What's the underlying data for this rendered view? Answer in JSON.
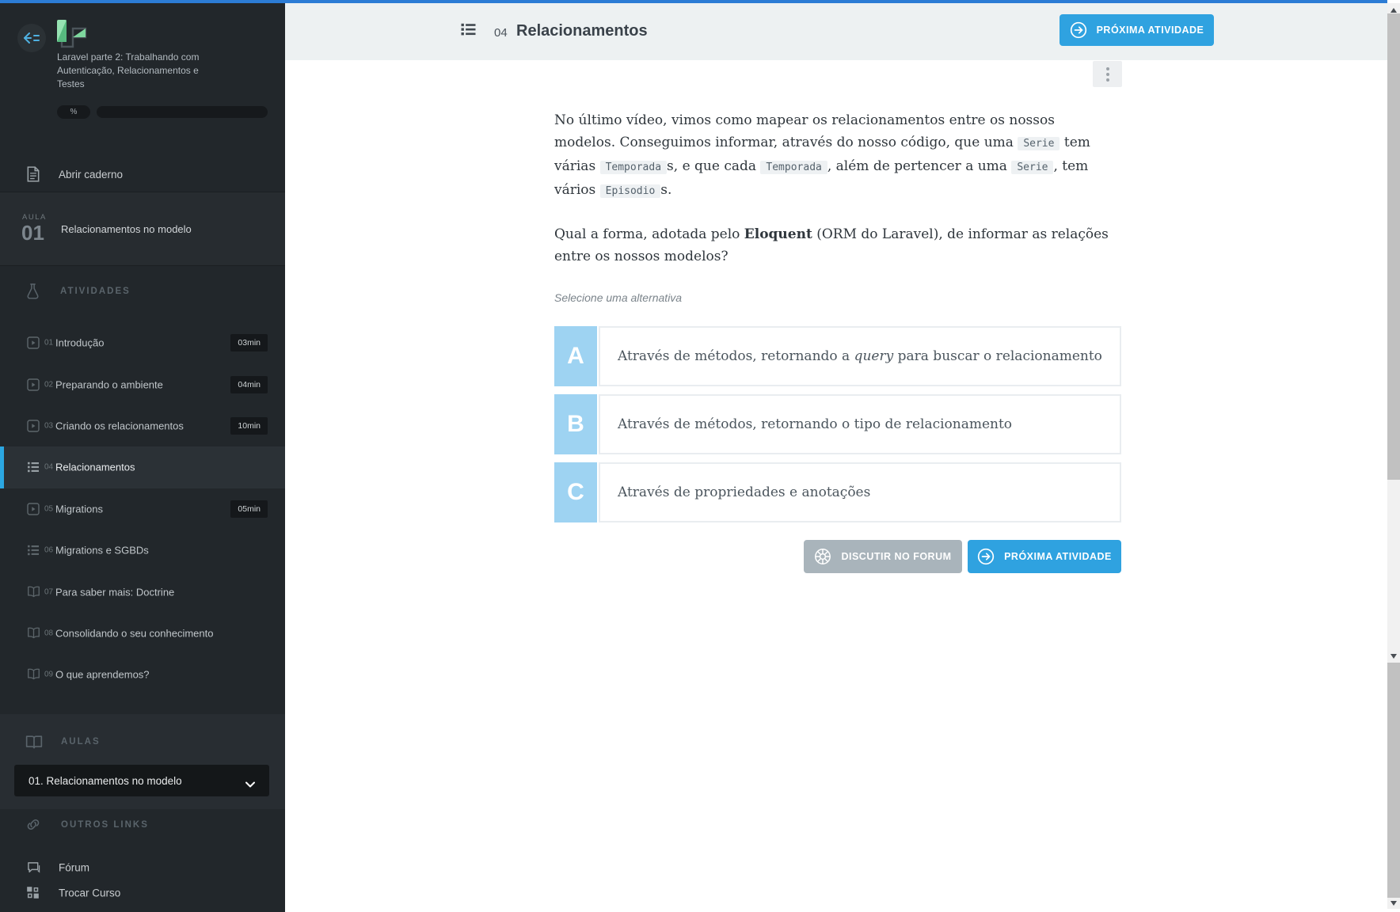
{
  "colors": {
    "topbar_blue": "#2c7cd5",
    "accent_blue": "#2fa2e0",
    "option_letter_blue": "#9ed3f2",
    "active_item_marker": "#2ba7e2",
    "gray_button": "#a9b4bb"
  },
  "sidebar": {
    "logo_icon": "laravel-course-logo",
    "course_title": "Laravel parte 2: Trabalhando com Autenticação, Relacionamentos e Testes",
    "progress_label": "%",
    "open_notebook": "Abrir caderno",
    "lesson": {
      "label": "AULA",
      "number": "01",
      "title": "Relacionamentos no modelo"
    },
    "activities_header": "ATIVIDADES",
    "activities": [
      {
        "num": "01",
        "label": "Introdução",
        "duration": "03min",
        "icon": "video"
      },
      {
        "num": "02",
        "label": "Preparando o ambiente",
        "duration": "04min",
        "icon": "video"
      },
      {
        "num": "03",
        "label": "Criando os relacionamentos",
        "duration": "10min",
        "icon": "video"
      },
      {
        "num": "04",
        "label": "Relacionamentos",
        "icon": "quiz",
        "active": true
      },
      {
        "num": "05",
        "label": "Migrations",
        "duration": "05min",
        "icon": "video"
      },
      {
        "num": "06",
        "label": "Migrations e SGBDs",
        "icon": "quiz"
      },
      {
        "num": "07",
        "label": "Para saber mais: Doctrine",
        "icon": "reading"
      },
      {
        "num": "08",
        "label": "Consolidando o seu conhecimento",
        "icon": "reading"
      },
      {
        "num": "09",
        "label": "O que aprendemos?",
        "icon": "reading"
      }
    ],
    "aulas_header": "AULAS",
    "aulas_selected": "01. Relacionamentos no modelo",
    "other_links_header": "OUTROS LINKS",
    "other_links": [
      {
        "label": "Fórum",
        "icon": "forum"
      },
      {
        "label": "Trocar Curso",
        "icon": "switch-course"
      }
    ]
  },
  "header": {
    "activity_number": "04",
    "activity_title": "Relacionamentos",
    "next_button": "PRÓXIMA ATIVIDADE"
  },
  "question": {
    "paragraph1": [
      {
        "t": "No último vídeo, vimos como mapear os relacionamentos entre os nossos"
      },
      {
        "br": true
      },
      {
        "t": "modelos. Conseguimos informar, através do nosso código, que uma "
      },
      {
        "c": "Serie"
      },
      {
        "t": " tem"
      },
      {
        "br": true
      },
      {
        "t": "várias "
      },
      {
        "c": "Temporada"
      },
      {
        "t": "s, e que cada "
      },
      {
        "c": "Temporada"
      },
      {
        "t": ", além de pertencer a uma "
      },
      {
        "c": "Serie"
      },
      {
        "t": ", tem"
      },
      {
        "br": true
      },
      {
        "t": "vários "
      },
      {
        "c": "Episodio"
      },
      {
        "t": "s."
      }
    ],
    "paragraph2": [
      {
        "t": "Qual a forma, adotada pelo "
      },
      {
        "b": "Eloquent"
      },
      {
        "t": " (ORM do Laravel), de informar as relações"
      },
      {
        "br": true
      },
      {
        "t": "entre os nossos modelos?"
      }
    ],
    "hint": "Selecione uma alternativa",
    "options": [
      {
        "letter": "A",
        "content": [
          {
            "t": "Através de métodos, retornando a "
          },
          {
            "i": "query"
          },
          {
            "t": " para buscar o relacionamento"
          }
        ]
      },
      {
        "letter": "B",
        "content": [
          {
            "t": "Através de métodos, retornando o tipo de relacionamento"
          }
        ]
      },
      {
        "letter": "C",
        "content": [
          {
            "t": "Através de propriedades e anotações"
          }
        ]
      }
    ],
    "discuss_button": "DISCUTIR NO FORUM",
    "next_button": "PRÓXIMA ATIVIDADE"
  }
}
